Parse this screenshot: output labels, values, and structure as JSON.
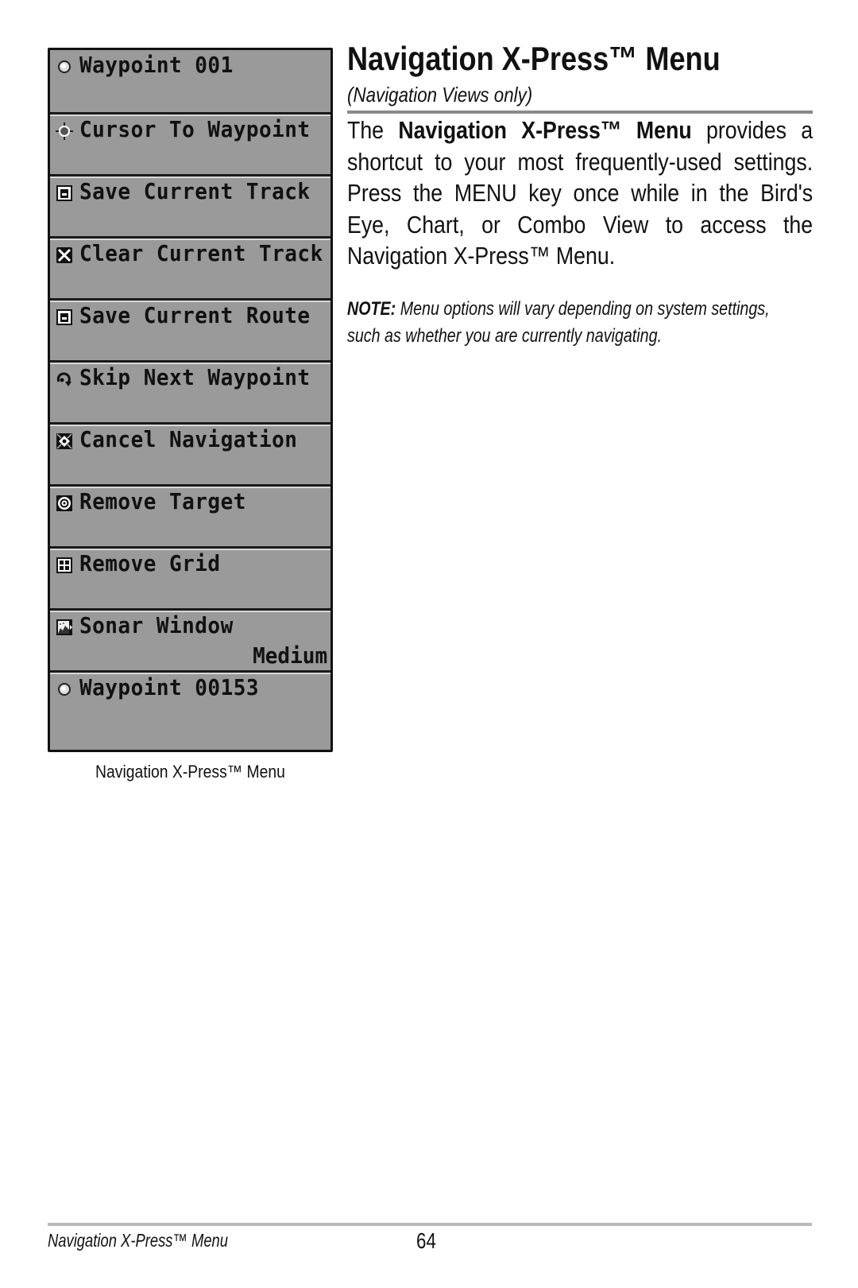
{
  "menu": {
    "items": [
      {
        "icon": "waypoint-icon",
        "label": "Waypoint 001",
        "value": ""
      },
      {
        "icon": "crosshair-icon",
        "label": "Cursor To Waypoint",
        "value": ""
      },
      {
        "icon": "save-icon",
        "label": "Save Current Track",
        "value": ""
      },
      {
        "icon": "clear-icon",
        "label": "Clear Current Track",
        "value": ""
      },
      {
        "icon": "save-icon",
        "label": "Save Current Route",
        "value": ""
      },
      {
        "icon": "skip-icon",
        "label": "Skip Next Waypoint",
        "value": ""
      },
      {
        "icon": "cancel-navigation-icon",
        "label": "Cancel Navigation",
        "value": ""
      },
      {
        "icon": "target-icon",
        "label": "Remove Target",
        "value": ""
      },
      {
        "icon": "grid-icon",
        "label": "Remove Grid",
        "value": ""
      },
      {
        "icon": "sonar-window-icon",
        "label": "Sonar Window",
        "value": "Medium"
      },
      {
        "icon": "waypoint-icon",
        "label": "Waypoint 00153",
        "value": ""
      }
    ],
    "caption": "Navigation X-Press™ Menu"
  },
  "section": {
    "title": "Navigation X-Press™ Menu",
    "subtitle": "(Navigation Views only)",
    "body_intro": "The ",
    "body_bold": "Navigation X-Press™ Menu",
    "body_rest": " provides a shortcut to your most frequently-used settings. Press the MENU key once while in the Bird's Eye, Chart, or Combo View to access the Navigation X-Press™ Menu.",
    "note_label": "NOTE:",
    "note_text": " Menu options will vary depending on system settings, such as whether you are currently navigating."
  },
  "footer": {
    "section_name": "Navigation X-Press™ Menu",
    "page_number": "64"
  },
  "colors": {
    "menu_background": "#9a9a9a",
    "menu_border": "#111111",
    "rule": "#8a8a8a"
  }
}
